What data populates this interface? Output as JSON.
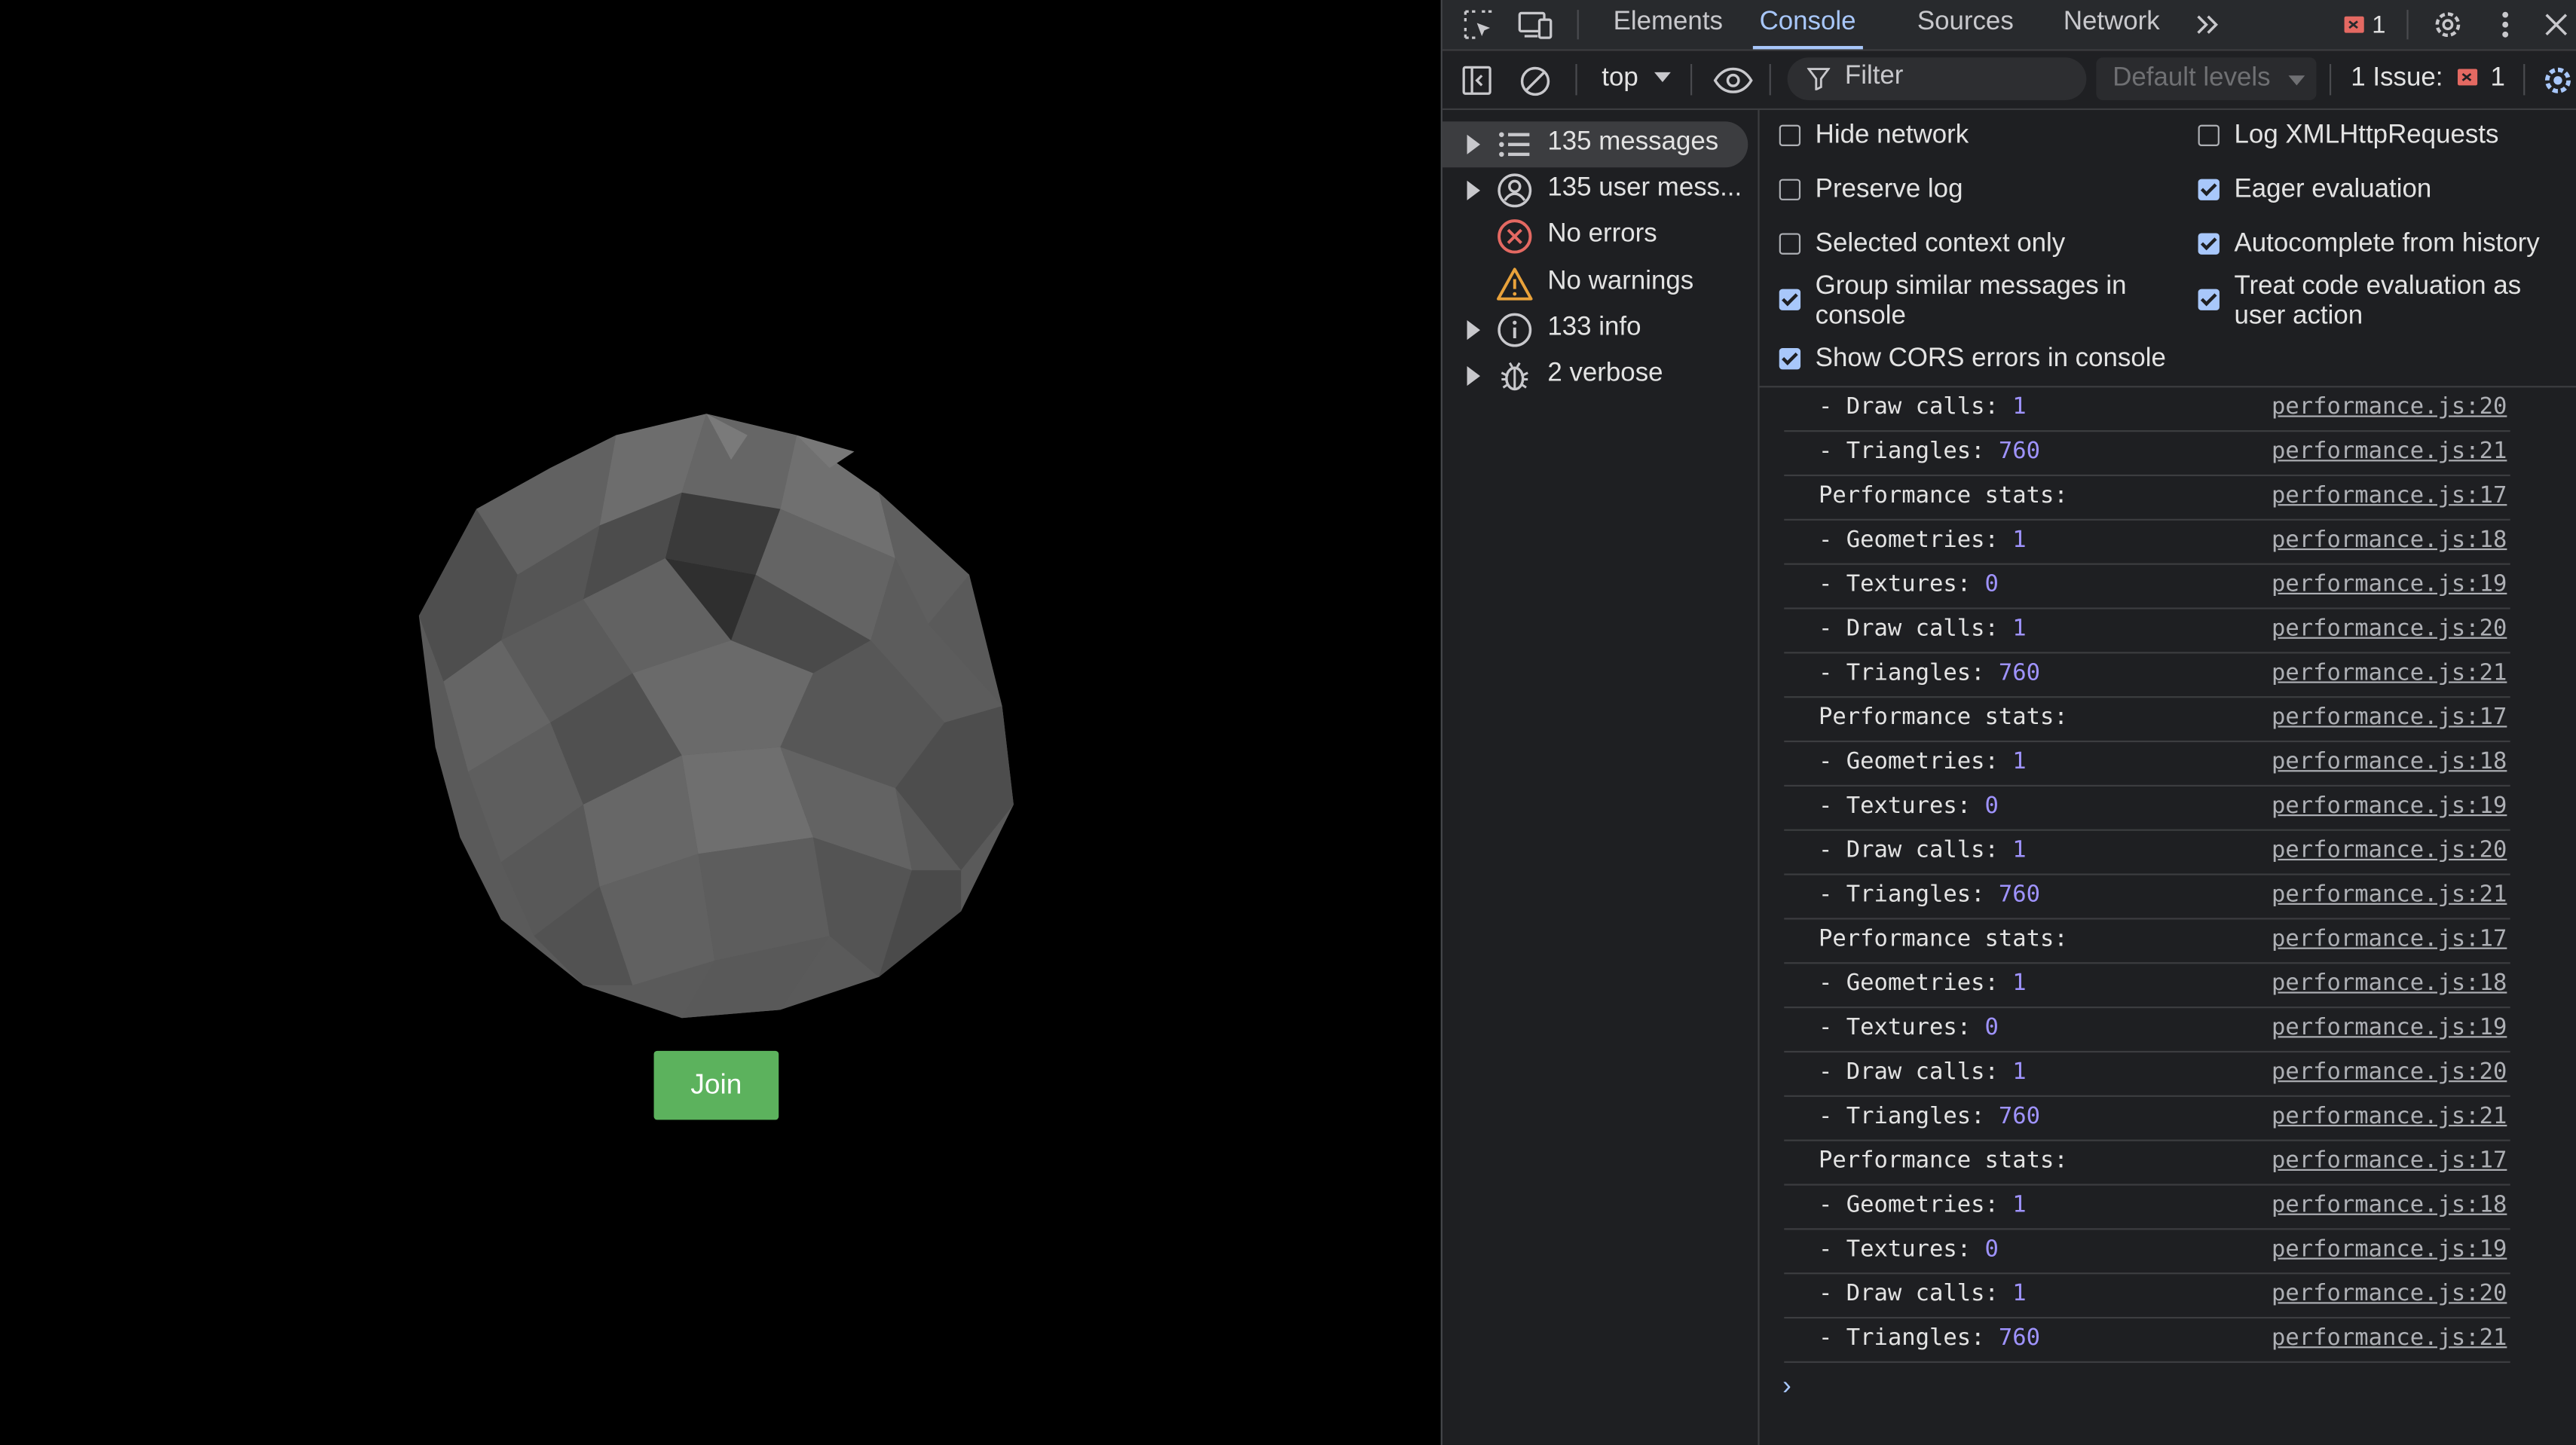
{
  "page": {
    "join_label": "Join",
    "colors": {
      "join_bg": "#5cb25d",
      "background": "#000000"
    }
  },
  "devtools": {
    "tabs": [
      {
        "label": "Elements",
        "active": false
      },
      {
        "label": "Console",
        "active": true
      },
      {
        "label": "Sources",
        "active": false
      },
      {
        "label": "Network",
        "active": false
      }
    ],
    "more_tabs_icon": "chevrons-right-icon",
    "issue_badge_count": "1",
    "toolbar": {
      "context": "top",
      "filter_placeholder": "Filter",
      "levels": "Default levels",
      "issues_label": "1 Issue:",
      "issues_count": "1"
    },
    "sidebar": [
      {
        "label": "135 messages",
        "icon": "list-icon",
        "expandable": true,
        "selected": true
      },
      {
        "label": "135 user mess...",
        "icon": "user-icon",
        "expandable": true,
        "selected": false
      },
      {
        "label": "No errors",
        "icon": "error-icon",
        "expandable": false,
        "selected": false
      },
      {
        "label": "No warnings",
        "icon": "warning-icon",
        "expandable": false,
        "selected": false
      },
      {
        "label": "133 info",
        "icon": "info-icon",
        "expandable": true,
        "selected": false
      },
      {
        "label": "2 verbose",
        "icon": "bug-icon",
        "expandable": true,
        "selected": false
      }
    ],
    "settings": {
      "left": [
        {
          "label": "Hide network",
          "checked": false
        },
        {
          "label": "Preserve log",
          "checked": false
        },
        {
          "label": "Selected context only",
          "checked": false
        },
        {
          "label": "Group similar messages in console",
          "checked": true
        },
        {
          "label": "Show CORS errors in console",
          "checked": true
        }
      ],
      "right": [
        {
          "label": "Log XMLHttpRequests",
          "checked": false
        },
        {
          "label": "Eager evaluation",
          "checked": true
        },
        {
          "label": "Autocomplete from history",
          "checked": true
        },
        {
          "label": "Treat code evaluation as user action",
          "checked": true
        }
      ]
    },
    "log": [
      {
        "text": "- Draw calls: ",
        "value": "1",
        "source": "performance.js:20"
      },
      {
        "text": "- Triangles: ",
        "value": "760",
        "source": "performance.js:21"
      },
      {
        "text": "Performance stats:",
        "value": "",
        "source": "performance.js:17"
      },
      {
        "text": "- Geometries: ",
        "value": "1",
        "source": "performance.js:18"
      },
      {
        "text": "- Textures: ",
        "value": "0",
        "source": "performance.js:19"
      },
      {
        "text": "- Draw calls: ",
        "value": "1",
        "source": "performance.js:20"
      },
      {
        "text": "- Triangles: ",
        "value": "760",
        "source": "performance.js:21"
      },
      {
        "text": "Performance stats:",
        "value": "",
        "source": "performance.js:17"
      },
      {
        "text": "- Geometries: ",
        "value": "1",
        "source": "performance.js:18"
      },
      {
        "text": "- Textures: ",
        "value": "0",
        "source": "performance.js:19"
      },
      {
        "text": "- Draw calls: ",
        "value": "1",
        "source": "performance.js:20"
      },
      {
        "text": "- Triangles: ",
        "value": "760",
        "source": "performance.js:21"
      },
      {
        "text": "Performance stats:",
        "value": "",
        "source": "performance.js:17"
      },
      {
        "text": "- Geometries: ",
        "value": "1",
        "source": "performance.js:18"
      },
      {
        "text": "- Textures: ",
        "value": "0",
        "source": "performance.js:19"
      },
      {
        "text": "- Draw calls: ",
        "value": "1",
        "source": "performance.js:20"
      },
      {
        "text": "- Triangles: ",
        "value": "760",
        "source": "performance.js:21"
      },
      {
        "text": "Performance stats:",
        "value": "",
        "source": "performance.js:17"
      },
      {
        "text": "- Geometries: ",
        "value": "1",
        "source": "performance.js:18"
      },
      {
        "text": "- Textures: ",
        "value": "0",
        "source": "performance.js:19"
      },
      {
        "text": "- Draw calls: ",
        "value": "1",
        "source": "performance.js:20"
      },
      {
        "text": "- Triangles: ",
        "value": "760",
        "source": "performance.js:21"
      }
    ],
    "prompt_symbol": "›"
  }
}
